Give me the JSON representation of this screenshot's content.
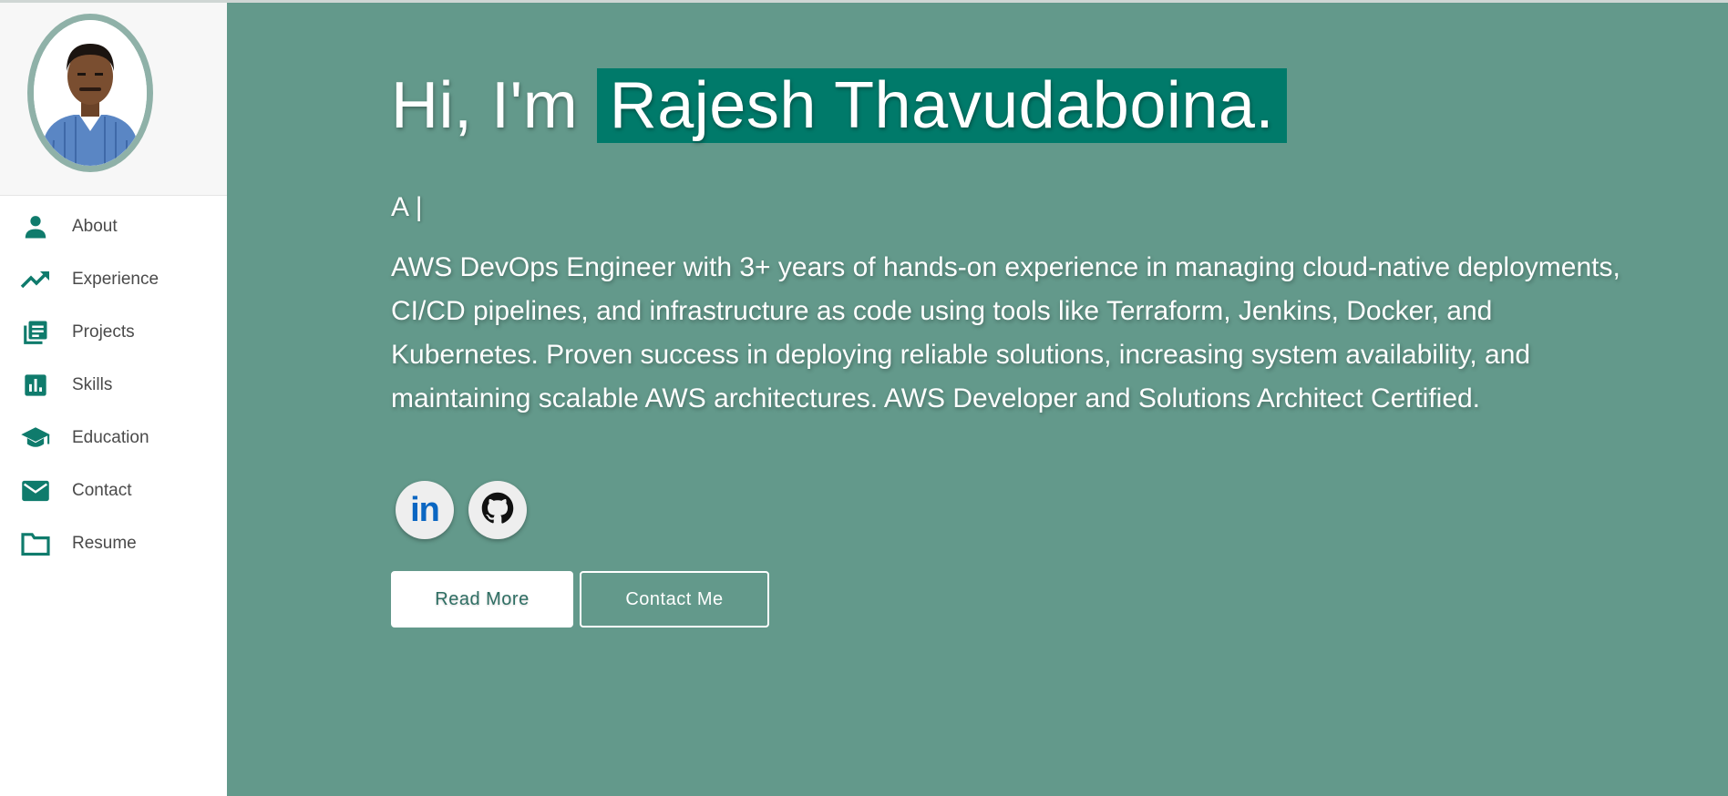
{
  "sidebar": {
    "avatar_alt": "Profile photo",
    "items": [
      {
        "label": "About",
        "icon": "person-icon"
      },
      {
        "label": "Experience",
        "icon": "trending-up-icon"
      },
      {
        "label": "Projects",
        "icon": "library-books-icon"
      },
      {
        "label": "Skills",
        "icon": "bar-chart-icon"
      },
      {
        "label": "Education",
        "icon": "school-icon"
      },
      {
        "label": "Contact",
        "icon": "mail-icon"
      },
      {
        "label": "Resume",
        "icon": "folder-icon"
      }
    ]
  },
  "hero": {
    "greeting": "Hi, I'm",
    "name": "Rajesh Thavudaboina.",
    "typed_text": "A |",
    "bio": "AWS DevOps Engineer with 3+ years of hands-on experience in managing cloud-native deployments, CI/CD pipelines, and infrastructure as code using tools like Terraform, Jenkins, Docker, and Kubernetes. Proven success in deploying reliable solutions, increasing system availability, and maintaining scalable AWS architectures. AWS Developer and Solutions Architect Certified.",
    "social": [
      {
        "name": "linkedin-icon",
        "text": "in"
      },
      {
        "name": "github-icon"
      }
    ],
    "read_more_label": "Read More",
    "contact_label": "Contact Me"
  },
  "colors": {
    "accent": "#007a6a",
    "main_bg": "#63998b",
    "icon": "#0f7b6c"
  }
}
